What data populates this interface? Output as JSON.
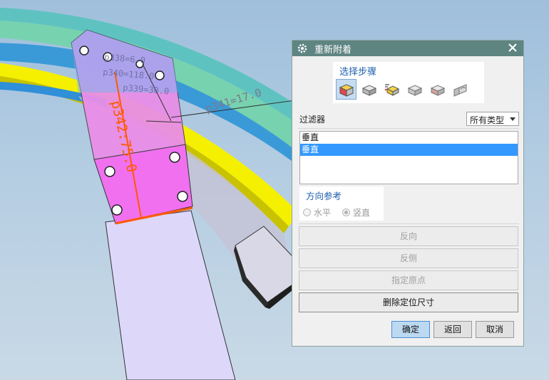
{
  "viewport": {
    "dimensions": [
      {
        "label": "p338=6.0"
      },
      {
        "label": "p340=118.0"
      },
      {
        "label": "p339=30.0"
      },
      {
        "label": "p341=17.0"
      },
      {
        "label": "p342:75.0"
      }
    ]
  },
  "dialog": {
    "title": "重新附着",
    "select_steps": {
      "label": "选择步骤",
      "icons": [
        "target-solid-icon",
        "reference-face-icon",
        "placement-icon",
        "vertical-reference-icon",
        "direction-reference-icon",
        "origin-icon"
      ]
    },
    "filter": {
      "label": "过滤器",
      "value": "所有类型"
    },
    "list": {
      "header": "垂直",
      "items": [
        "垂直"
      ]
    },
    "direction_ref": {
      "label": "方向参考",
      "options": [
        {
          "label": "水平",
          "checked": false
        },
        {
          "label": "竖直",
          "checked": true
        }
      ]
    },
    "buttons": {
      "reverse": "反向",
      "flip_side": "反侧",
      "origin": "指定原点",
      "delete_dims": "删除定位尺寸",
      "ok": "确定",
      "back": "返回",
      "cancel": "取消"
    }
  }
}
